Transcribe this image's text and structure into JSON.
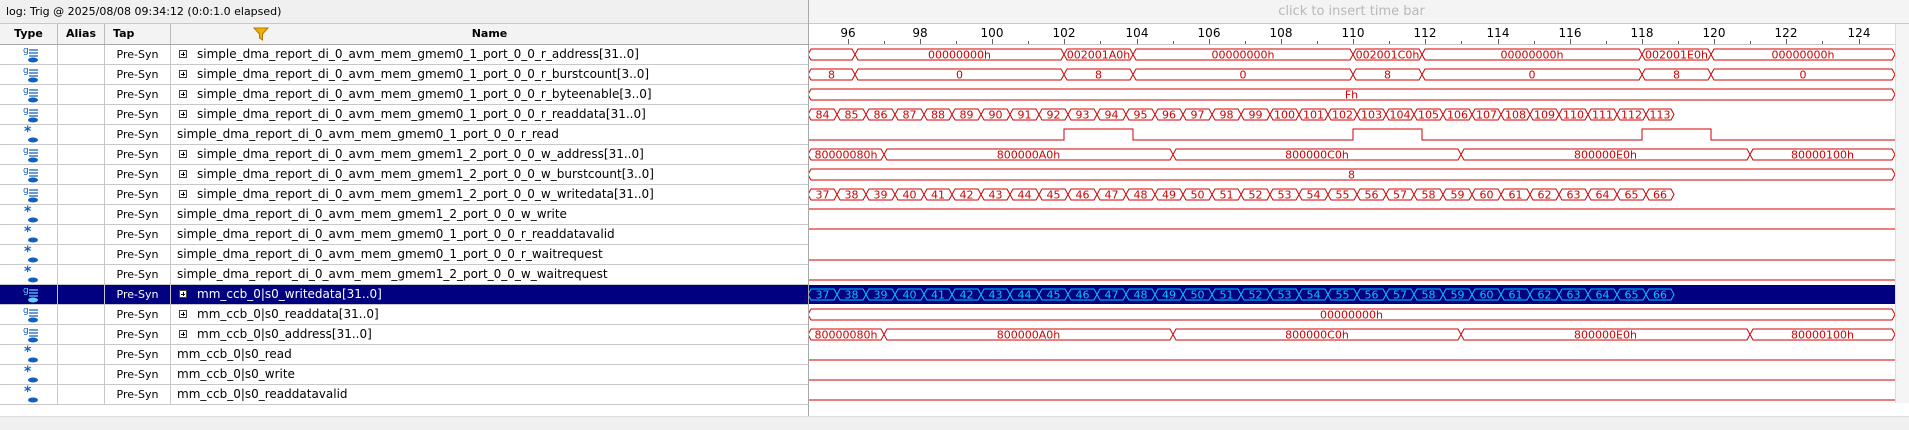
{
  "log_title": "log: Trig @ 2025/08/08 09:34:12 (0:0:1.0 elapsed)",
  "time_bar_hint": "click to insert time bar",
  "columns": {
    "type": "Type",
    "alias": "Alias",
    "tap": "Tap",
    "name": "Name"
  },
  "colors": {
    "waveform": "#d00000",
    "selected_waveform": "#00c8ff",
    "selected_row": "#000080"
  },
  "ruler": {
    "labels": [
      "96",
      "98",
      "100",
      "102",
      "104",
      "106",
      "108",
      "110",
      "112",
      "114",
      "116",
      "118",
      "120",
      "122",
      "124"
    ]
  },
  "signals": [
    {
      "type_icon": "bus-icon",
      "tap": "Pre-Syn",
      "expandable": true,
      "name": "simple_dma_report_di_0_avm_mem_gmem0_1_port_0_0_r_address[31..0]"
    },
    {
      "type_icon": "bus-icon",
      "tap": "Pre-Syn",
      "expandable": true,
      "name": "simple_dma_report_di_0_avm_mem_gmem0_1_port_0_0_r_burstcount[3..0]"
    },
    {
      "type_icon": "bus-icon",
      "tap": "Pre-Syn",
      "expandable": true,
      "name": "simple_dma_report_di_0_avm_mem_gmem0_1_port_0_0_r_byteenable[3..0]"
    },
    {
      "type_icon": "bus-icon",
      "tap": "Pre-Syn",
      "expandable": true,
      "name": "simple_dma_report_di_0_avm_mem_gmem0_1_port_0_0_r_readdata[31..0]"
    },
    {
      "type_icon": "output-icon",
      "tap": "Pre-Syn",
      "expandable": false,
      "name": "simple_dma_report_di_0_avm_mem_gmem0_1_port_0_0_r_read"
    },
    {
      "type_icon": "bus-icon",
      "tap": "Pre-Syn",
      "expandable": true,
      "name": "simple_dma_report_di_0_avm_mem_gmem1_2_port_0_0_w_address[31..0]"
    },
    {
      "type_icon": "bus-icon",
      "tap": "Pre-Syn",
      "expandable": true,
      "name": "simple_dma_report_di_0_avm_mem_gmem1_2_port_0_0_w_burstcount[3..0]"
    },
    {
      "type_icon": "bus-icon",
      "tap": "Pre-Syn",
      "expandable": true,
      "name": "simple_dma_report_di_0_avm_mem_gmem1_2_port_0_0_w_writedata[31..0]"
    },
    {
      "type_icon": "input-icon",
      "tap": "Pre-Syn",
      "expandable": false,
      "name": "simple_dma_report_di_0_avm_mem_gmem1_2_port_0_0_w_write"
    },
    {
      "type_icon": "input-icon",
      "tap": "Pre-Syn",
      "expandable": false,
      "name": "simple_dma_report_di_0_avm_mem_gmem0_1_port_0_0_r_readdatavalid"
    },
    {
      "type_icon": "input-icon",
      "tap": "Pre-Syn",
      "expandable": false,
      "name": "simple_dma_report_di_0_avm_mem_gmem0_1_port_0_0_r_waitrequest"
    },
    {
      "type_icon": "input-icon",
      "tap": "Pre-Syn",
      "expandable": false,
      "name": "simple_dma_report_di_0_avm_mem_gmem1_2_port_0_0_w_waitrequest"
    },
    {
      "type_icon": "bus-icon",
      "tap": "Pre-Syn",
      "expandable": true,
      "name": "mm_ccb_0|s0_writedata[31..0]",
      "selected": true
    },
    {
      "type_icon": "bus-icon",
      "tap": "Pre-Syn",
      "expandable": true,
      "name": "mm_ccb_0|s0_readdata[31..0]"
    },
    {
      "type_icon": "bus-icon",
      "tap": "Pre-Syn",
      "expandable": true,
      "name": "mm_ccb_0|s0_address[31..0]"
    },
    {
      "type_icon": "input-icon",
      "tap": "Pre-Syn",
      "expandable": false,
      "name": "mm_ccb_0|s0_read"
    },
    {
      "type_icon": "input-icon",
      "tap": "Pre-Syn",
      "expandable": false,
      "name": "mm_ccb_0|s0_write"
    },
    {
      "type_icon": "input-icon",
      "tap": "Pre-Syn",
      "expandable": false,
      "name": "mm_ccb_0|s0_readdatavalid"
    }
  ],
  "waveforms": [
    {
      "kind": "bus",
      "segments": [
        {
          "from": 94.9,
          "to": 96.2,
          "label": ""
        },
        {
          "from": 96.2,
          "to": 102.0,
          "label": "00000000h"
        },
        {
          "from": 102.0,
          "to": 103.9,
          "label": "002001A0h"
        },
        {
          "from": 103.9,
          "to": 110.0,
          "label": "00000000h"
        },
        {
          "from": 110.0,
          "to": 111.9,
          "label": "002001C0h"
        },
        {
          "from": 111.9,
          "to": 118.0,
          "label": "00000000h"
        },
        {
          "from": 118.0,
          "to": 119.9,
          "label": "002001E0h"
        },
        {
          "from": 119.9,
          "to": 125.0,
          "label": "00000000h"
        }
      ]
    },
    {
      "kind": "bus",
      "segments": [
        {
          "from": 94.9,
          "to": 96.2,
          "label": "8"
        },
        {
          "from": 96.2,
          "to": 102.0,
          "label": "0"
        },
        {
          "from": 102.0,
          "to": 103.9,
          "label": "8"
        },
        {
          "from": 103.9,
          "to": 110.0,
          "label": "0"
        },
        {
          "from": 110.0,
          "to": 111.9,
          "label": "8"
        },
        {
          "from": 111.9,
          "to": 118.0,
          "label": "0"
        },
        {
          "from": 118.0,
          "to": 119.9,
          "label": "8"
        },
        {
          "from": 119.9,
          "to": 125.0,
          "label": "0"
        }
      ]
    },
    {
      "kind": "bus",
      "segments": [
        {
          "from": 94.9,
          "to": 125.0,
          "label": "Fh"
        }
      ]
    },
    {
      "kind": "bus",
      "segments": [
        {
          "from": 94.9,
          "to": 95.7,
          "label": "84"
        },
        {
          "from": 95.7,
          "to": 96.5,
          "label": "85"
        },
        {
          "from": 96.5,
          "to": 97.3,
          "label": "86"
        },
        {
          "from": 97.3,
          "to": 98.1,
          "label": "87"
        },
        {
          "from": 98.1,
          "to": 98.9,
          "label": "88"
        },
        {
          "from": 98.9,
          "to": 99.7,
          "label": "89"
        },
        {
          "from": 99.7,
          "to": 100.5,
          "label": "90"
        },
        {
          "from": 100.5,
          "to": 101.3,
          "label": "91"
        },
        {
          "from": 101.3,
          "to": 102.1,
          "label": "92"
        },
        {
          "from": 102.1,
          "to": 102.9,
          "label": "93"
        },
        {
          "from": 102.9,
          "to": 103.7,
          "label": "94"
        },
        {
          "from": 103.7,
          "to": 104.5,
          "label": "95"
        },
        {
          "from": 104.5,
          "to": 105.3,
          "label": "96"
        },
        {
          "from": 105.3,
          "to": 106.1,
          "label": "97"
        },
        {
          "from": 106.1,
          "to": 106.9,
          "label": "98"
        },
        {
          "from": 106.9,
          "to": 107.7,
          "label": "99"
        },
        {
          "from": 107.7,
          "to": 108.5,
          "label": "100"
        },
        {
          "from": 108.5,
          "to": 109.3,
          "label": "101"
        },
        {
          "from": 109.3,
          "to": 110.1,
          "label": "102"
        },
        {
          "from": 110.1,
          "to": 110.9,
          "label": "103"
        },
        {
          "from": 110.9,
          "to": 111.7,
          "label": "104"
        },
        {
          "from": 111.7,
          "to": 112.5,
          "label": "105"
        },
        {
          "from": 112.5,
          "to": 113.3,
          "label": "106"
        },
        {
          "from": 113.3,
          "to": 114.1,
          "label": "107"
        },
        {
          "from": 114.1,
          "to": 114.9,
          "label": "108"
        },
        {
          "from": 114.9,
          "to": 115.7,
          "label": "109"
        },
        {
          "from": 115.7,
          "to": 116.5,
          "label": "110"
        },
        {
          "from": 116.5,
          "to": 117.3,
          "label": "111"
        },
        {
          "from": 117.3,
          "to": 118.1,
          "label": "112"
        },
        {
          "from": 118.1,
          "to": 118.9,
          "label": "113"
        }
      ]
    },
    {
      "kind": "bit",
      "initial": 0,
      "edges": [
        94.9,
        102.0,
        103.9,
        110.0,
        111.9,
        118.0,
        119.9
      ],
      "levels": [
        1,
        0,
        1,
        0,
        1,
        0,
        1,
        0
      ]
    },
    {
      "kind": "bus",
      "segments": [
        {
          "from": 94.9,
          "to": 97.0,
          "label": "80000080h"
        },
        {
          "from": 97.0,
          "to": 105.0,
          "label": "800000A0h"
        },
        {
          "from": 105.0,
          "to": 113.0,
          "label": "800000C0h"
        },
        {
          "from": 113.0,
          "to": 121.0,
          "label": "800000E0h"
        },
        {
          "from": 121.0,
          "to": 125.0,
          "label": "80000100h"
        }
      ]
    },
    {
      "kind": "bus",
      "segments": [
        {
          "from": 94.9,
          "to": 125.0,
          "label": "8"
        }
      ]
    },
    {
      "kind": "bus",
      "segments": [
        {
          "from": 94.9,
          "to": 95.7,
          "label": "37"
        },
        {
          "from": 95.7,
          "to": 96.5,
          "label": "38"
        },
        {
          "from": 96.5,
          "to": 97.3,
          "label": "39"
        },
        {
          "from": 97.3,
          "to": 98.1,
          "label": "40"
        },
        {
          "from": 98.1,
          "to": 98.9,
          "label": "41"
        },
        {
          "from": 98.9,
          "to": 99.7,
          "label": "42"
        },
        {
          "from": 99.7,
          "to": 100.5,
          "label": "43"
        },
        {
          "from": 100.5,
          "to": 101.3,
          "label": "44"
        },
        {
          "from": 101.3,
          "to": 102.1,
          "label": "45"
        },
        {
          "from": 102.1,
          "to": 102.9,
          "label": "46"
        },
        {
          "from": 102.9,
          "to": 103.7,
          "label": "47"
        },
        {
          "from": 103.7,
          "to": 104.5,
          "label": "48"
        },
        {
          "from": 104.5,
          "to": 105.3,
          "label": "49"
        },
        {
          "from": 105.3,
          "to": 106.1,
          "label": "50"
        },
        {
          "from": 106.1,
          "to": 106.9,
          "label": "51"
        },
        {
          "from": 106.9,
          "to": 107.7,
          "label": "52"
        },
        {
          "from": 107.7,
          "to": 108.5,
          "label": "53"
        },
        {
          "from": 108.5,
          "to": 109.3,
          "label": "54"
        },
        {
          "from": 109.3,
          "to": 110.1,
          "label": "55"
        },
        {
          "from": 110.1,
          "to": 110.9,
          "label": "56"
        },
        {
          "from": 110.9,
          "to": 111.7,
          "label": "57"
        },
        {
          "from": 111.7,
          "to": 112.5,
          "label": "58"
        },
        {
          "from": 112.5,
          "to": 113.3,
          "label": "59"
        },
        {
          "from": 113.3,
          "to": 114.1,
          "label": "60"
        },
        {
          "from": 114.1,
          "to": 114.9,
          "label": "61"
        },
        {
          "from": 114.9,
          "to": 115.7,
          "label": "62"
        },
        {
          "from": 115.7,
          "to": 116.5,
          "label": "63"
        },
        {
          "from": 116.5,
          "to": 117.3,
          "label": "64"
        },
        {
          "from": 117.3,
          "to": 118.1,
          "label": "65"
        },
        {
          "from": 118.1,
          "to": 118.9,
          "label": "66"
        }
      ]
    },
    {
      "kind": "bit",
      "initial": 1,
      "edges": [],
      "levels": [
        1
      ]
    },
    {
      "kind": "bit",
      "initial": 1,
      "edges": [],
      "levels": [
        1
      ]
    },
    {
      "kind": "bit",
      "initial": 0,
      "edges": [],
      "levels": [
        0
      ]
    },
    {
      "kind": "bit",
      "initial": 0,
      "edges": [],
      "levels": [
        0
      ]
    },
    {
      "kind": "bus",
      "segments": [
        {
          "from": 94.9,
          "to": 95.7,
          "label": "37"
        },
        {
          "from": 95.7,
          "to": 96.5,
          "label": "38"
        },
        {
          "from": 96.5,
          "to": 97.3,
          "label": "39"
        },
        {
          "from": 97.3,
          "to": 98.1,
          "label": "40"
        },
        {
          "from": 98.1,
          "to": 98.9,
          "label": "41"
        },
        {
          "from": 98.9,
          "to": 99.7,
          "label": "42"
        },
        {
          "from": 99.7,
          "to": 100.5,
          "label": "43"
        },
        {
          "from": 100.5,
          "to": 101.3,
          "label": "44"
        },
        {
          "from": 101.3,
          "to": 102.1,
          "label": "45"
        },
        {
          "from": 102.1,
          "to": 102.9,
          "label": "46"
        },
        {
          "from": 102.9,
          "to": 103.7,
          "label": "47"
        },
        {
          "from": 103.7,
          "to": 104.5,
          "label": "48"
        },
        {
          "from": 104.5,
          "to": 105.3,
          "label": "49"
        },
        {
          "from": 105.3,
          "to": 106.1,
          "label": "50"
        },
        {
          "from": 106.1,
          "to": 106.9,
          "label": "51"
        },
        {
          "from": 106.9,
          "to": 107.7,
          "label": "52"
        },
        {
          "from": 107.7,
          "to": 108.5,
          "label": "53"
        },
        {
          "from": 108.5,
          "to": 109.3,
          "label": "54"
        },
        {
          "from": 109.3,
          "to": 110.1,
          "label": "55"
        },
        {
          "from": 110.1,
          "to": 110.9,
          "label": "56"
        },
        {
          "from": 110.9,
          "to": 111.7,
          "label": "57"
        },
        {
          "from": 111.7,
          "to": 112.5,
          "label": "58"
        },
        {
          "from": 112.5,
          "to": 113.3,
          "label": "59"
        },
        {
          "from": 113.3,
          "to": 114.1,
          "label": "60"
        },
        {
          "from": 114.1,
          "to": 114.9,
          "label": "61"
        },
        {
          "from": 114.9,
          "to": 115.7,
          "label": "62"
        },
        {
          "from": 115.7,
          "to": 116.5,
          "label": "63"
        },
        {
          "from": 116.5,
          "to": 117.3,
          "label": "64"
        },
        {
          "from": 117.3,
          "to": 118.1,
          "label": "65"
        },
        {
          "from": 118.1,
          "to": 118.9,
          "label": "66"
        }
      ]
    },
    {
      "kind": "bus",
      "segments": [
        {
          "from": 94.9,
          "to": 125.0,
          "label": "00000000h"
        }
      ]
    },
    {
      "kind": "bus",
      "segments": [
        {
          "from": 94.9,
          "to": 97.0,
          "label": "80000080h"
        },
        {
          "from": 97.0,
          "to": 105.0,
          "label": "800000A0h"
        },
        {
          "from": 105.0,
          "to": 113.0,
          "label": "800000C0h"
        },
        {
          "from": 113.0,
          "to": 121.0,
          "label": "800000E0h"
        },
        {
          "from": 121.0,
          "to": 125.0,
          "label": "80000100h"
        }
      ]
    },
    {
      "kind": "bit",
      "initial": 0,
      "edges": [],
      "levels": [
        0
      ]
    },
    {
      "kind": "bit",
      "initial": 0,
      "edges": [],
      "levels": [
        0
      ]
    },
    {
      "kind": "bit",
      "initial": 0,
      "edges": [],
      "levels": [
        0
      ]
    }
  ]
}
